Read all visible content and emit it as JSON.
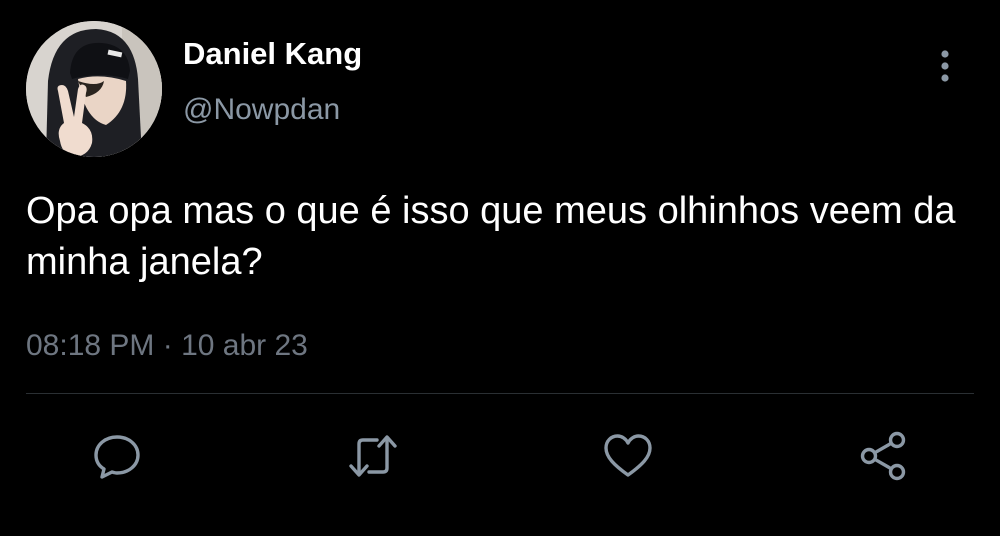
{
  "user": {
    "display_name": "Daniel Kang",
    "handle": "@Nowpdan"
  },
  "tweet": {
    "text": "Opa opa mas o que é isso que meus olhinhos veem da minha janela?",
    "time": "08:18 PM",
    "separator": " · ",
    "date": "10 abr 23"
  },
  "icons": {
    "more": "more-vertical-icon",
    "reply": "reply-icon",
    "retweet": "retweet-icon",
    "like": "heart-icon",
    "share": "share-icon"
  },
  "colors": {
    "background": "#000000",
    "primary_text": "#ffffff",
    "secondary_text": "#8b98a5",
    "icon": "#8b98a5",
    "divider": "#2a2f33"
  }
}
